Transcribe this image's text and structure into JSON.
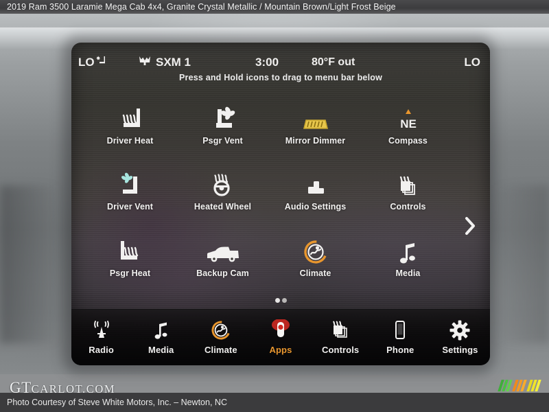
{
  "caption": "2019 Ram 3500 Laramie Mega Cab 4x4,  Granite Crystal Metallic / Mountain Brown/Light Frost Beige",
  "colors": {
    "accent_amber": "#e8962e",
    "mirror_amber": "#e7c64b",
    "compass_arrow": "#e8962e",
    "apps_red": "#d32a22",
    "icon_white": "#f2f1f0",
    "vent_blue": "#a8e6e0"
  },
  "screen": {
    "status": {
      "left_temp": "LO",
      "left_icon": "seat-climate-icon",
      "source_icon": "satellite-radio-icon",
      "source": "SXM 1",
      "time": "3:00",
      "outside_temp": "80°F out",
      "right_temp": "LO"
    },
    "hint": "Press and Hold icons to drag to menu bar below",
    "grid": [
      {
        "label": "Driver Heat",
        "icon": "seat-heat-icon"
      },
      {
        "label": "Psgr Vent",
        "icon": "seat-vent-icon"
      },
      {
        "label": "Mirror Dimmer",
        "icon": "mirror-dimmer-icon"
      },
      {
        "label": "Compass",
        "icon": "compass-icon",
        "value": "NE"
      },
      {
        "label": "Driver Vent",
        "icon": "seat-vent-icon"
      },
      {
        "label": "Heated Wheel",
        "icon": "heated-steering-wheel-icon"
      },
      {
        "label": "Audio Settings",
        "icon": "audio-settings-icon"
      },
      {
        "label": "Controls",
        "icon": "controls-icon"
      },
      {
        "label": "Psgr Heat",
        "icon": "seat-heat-icon"
      },
      {
        "label": "Backup Cam",
        "icon": "backup-camera-icon"
      },
      {
        "label": "Climate",
        "icon": "climate-icon"
      },
      {
        "label": "Media",
        "icon": "media-note-icon"
      }
    ],
    "next_page_icon": "chevron-right-icon",
    "page_dots": {
      "count": 2,
      "active_index": 0
    },
    "menubar": [
      {
        "label": "Radio",
        "icon": "radio-antenna-icon",
        "active": false
      },
      {
        "label": "Media",
        "icon": "media-note-icon",
        "active": false
      },
      {
        "label": "Climate",
        "icon": "climate-icon",
        "active": false
      },
      {
        "label": "Apps",
        "icon": "apps-icon",
        "active": true
      },
      {
        "label": "Controls",
        "icon": "controls-icon",
        "active": false
      },
      {
        "label": "Phone",
        "icon": "phone-icon",
        "active": false
      },
      {
        "label": "Settings",
        "icon": "gear-icon",
        "active": false
      }
    ]
  },
  "watermark": {
    "gt": "GT",
    "rest": "CARLOT.COM"
  },
  "footer": "Photo Courtesy of Steve White Motors, Inc. – Newton, NC"
}
